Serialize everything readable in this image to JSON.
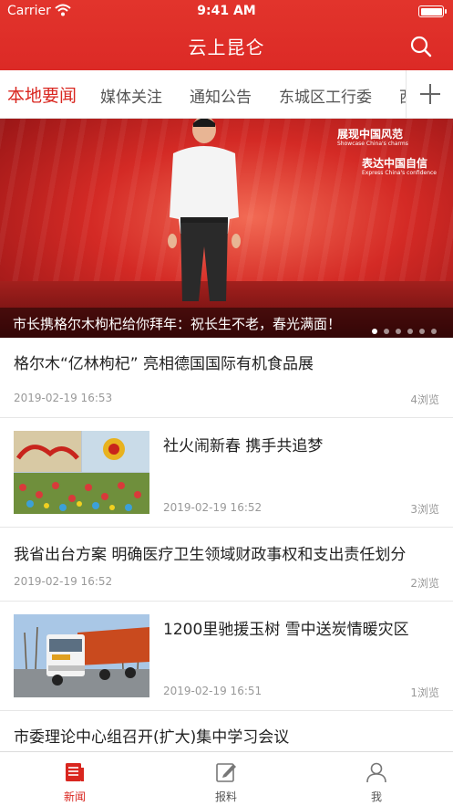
{
  "status_bar": {
    "carrier": "Carrier",
    "time": "9:41 AM"
  },
  "app_title": "云上昆仑",
  "tabs": [
    {
      "label": "本地要闻",
      "active": true
    },
    {
      "label": "媒体关注"
    },
    {
      "label": "通知公告"
    },
    {
      "label": "东城区工行委"
    },
    {
      "label": "西"
    }
  ],
  "banner": {
    "caption": "市长携格尔木枸杞给你拜年：祝长生不老，春光满面！",
    "slogan1": "展现中国风范",
    "slogan1_en": "Showcase China's charms",
    "slogan2": "表达中国自信",
    "slogan2_en": "Express China's confidence",
    "slides": 6,
    "current_slide": 1
  },
  "news": [
    {
      "title": "格尔木“亿林枸杞” 亮相德国国际有机食品展",
      "date": "2019-02-19 16:53",
      "views": "4浏览",
      "thumbnail": null
    },
    {
      "title": "社火闹新春 携手共追梦",
      "date": "2019-02-19 16:52",
      "views": "3浏览",
      "thumbnail": "folk-festival-collage"
    },
    {
      "title": "我省出台方案 明确医疗卫生领域财政事权和支出责任划分",
      "date": "2019-02-19 16:52",
      "views": "2浏览",
      "thumbnail": null
    },
    {
      "title": "1200里驰援玉树 雪中送炭情暖灾区",
      "date": "2019-02-19 16:51",
      "views": "1浏览",
      "thumbnail": "relief-truck"
    },
    {
      "title": "市委理论中心组召开(扩大)集中学习会议"
    }
  ],
  "tabbar": [
    {
      "label": "新闻",
      "icon": "news-icon",
      "active": true
    },
    {
      "label": "报料",
      "icon": "edit-icon"
    },
    {
      "label": "我",
      "icon": "user-icon"
    }
  ],
  "colors": {
    "brand_red": "#dc2a26",
    "active_tab": "#d9261f",
    "meta_gray": "#999999"
  }
}
